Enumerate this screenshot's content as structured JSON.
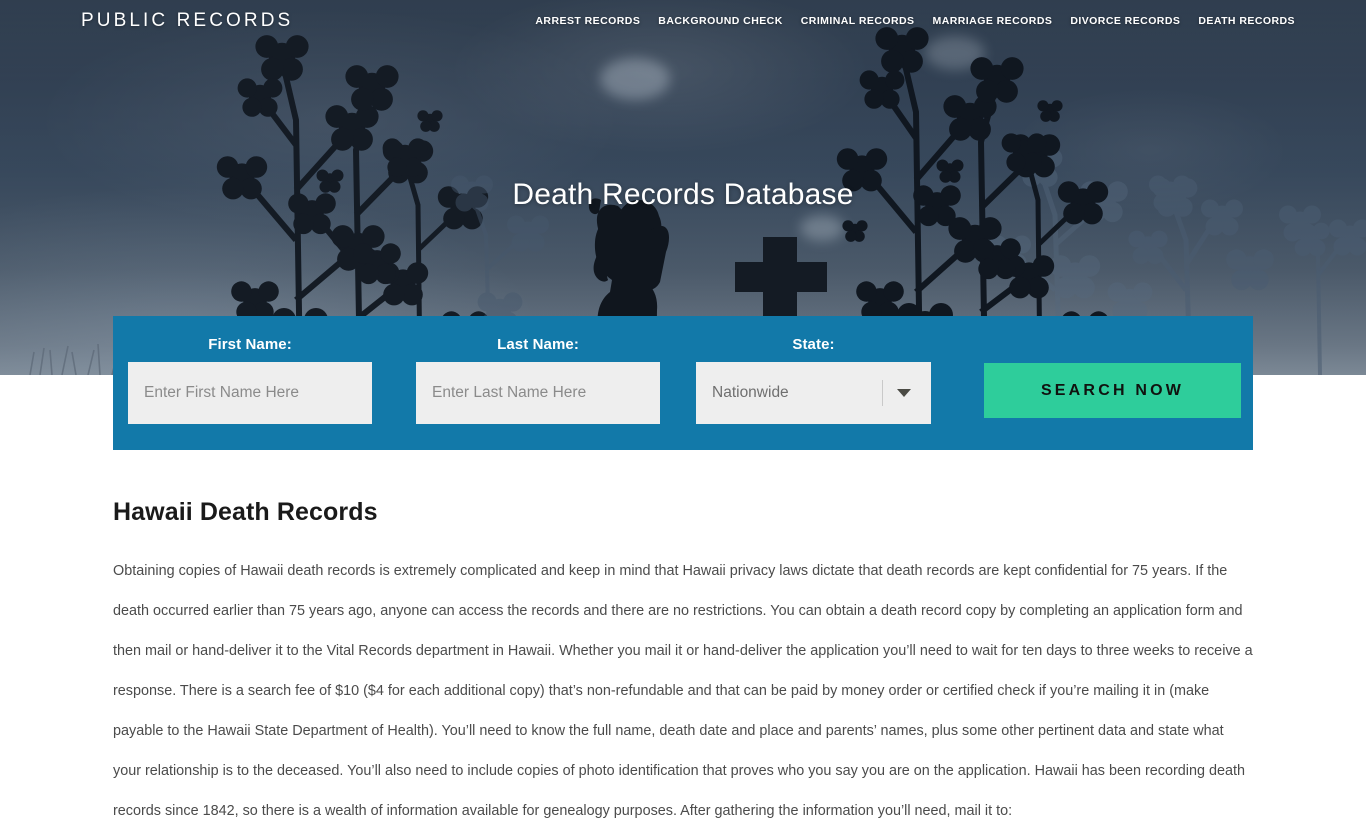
{
  "header": {
    "brand": "PUBLIC RECORDS",
    "nav": [
      {
        "label": "ARREST RECORDS"
      },
      {
        "label": "BACKGROUND CHECK"
      },
      {
        "label": "CRIMINAL RECORDS"
      },
      {
        "label": "MARRIAGE RECORDS"
      },
      {
        "label": "DIVORCE RECORDS"
      },
      {
        "label": "DEATH RECORDS"
      }
    ]
  },
  "hero": {
    "title": "Death Records Database"
  },
  "search_form": {
    "first_name": {
      "label": "First Name:",
      "placeholder": "Enter First Name Here",
      "value": ""
    },
    "last_name": {
      "label": "Last Name:",
      "placeholder": "Enter Last Name Here",
      "value": ""
    },
    "state": {
      "label": "State:",
      "selected": "Nationwide"
    },
    "submit_label": "SEARCH NOW"
  },
  "main": {
    "title": "Hawaii Death Records",
    "paragraph": "Obtaining copies of Hawaii death records is extremely complicated and keep in mind that Hawaii privacy laws dictate that death records are kept confidential for 75 years. If the death occurred earlier than 75 years ago, anyone can access the records and there are no restrictions. You can obtain a death record copy by completing an application form and then mail or hand-deliver it to the Vital Records department in Hawaii. Whether you mail it or hand-deliver the application you’ll need to wait for ten days to three weeks to receive a response. There is a search fee of $10 ($4 for each additional copy) that’s non-refundable and that can be paid by money order or certified check if you’re mailing it in (make payable to the Hawaii State Department of Health). You’ll need to know the full name, death date and place and parents’ names, plus some other pertinent data and state what your relationship is to the deceased. You’ll also need to include copies of photo identification that proves who you say you are on the application. Hawaii has been recording death records since 1842, so there is a wealth of information available for genealogy purposes. After gathering the information you’ll need, mail it to:"
  },
  "colors": {
    "panel_blue": "#1279a9",
    "button_green": "#2ecd9b",
    "hero_dark": "#3b4a5b",
    "text_body": "#4b4b4b"
  }
}
